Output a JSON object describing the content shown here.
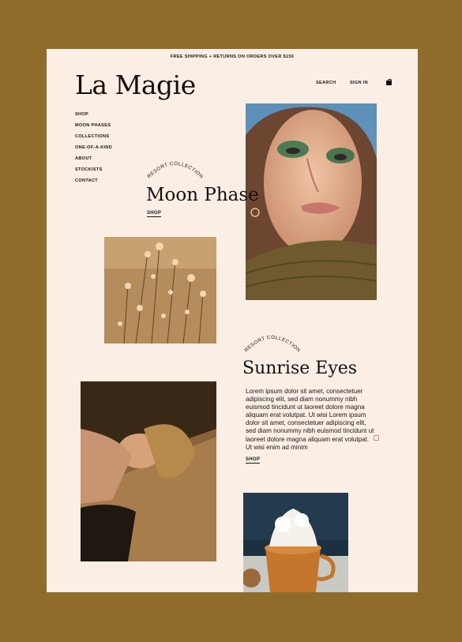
{
  "announcement": "FREE SHIPPING + RETURNS ON ORDERS OVER $150",
  "brand": "La Magie",
  "header": {
    "search": "SEARCH",
    "sign_in": "SIGN IN",
    "bag_icon": "shopping-bag-icon"
  },
  "nav": [
    "SHOP",
    "MOON PHASES",
    "COLLECTIONS",
    "ONE-OF-A-KIND",
    "ABOUT",
    "STOCKISTS",
    "CONTACT"
  ],
  "feature1": {
    "eyebrow": "RESORT COLLECTION",
    "title": "Moon Phase",
    "cta": "SHOP"
  },
  "feature2": {
    "eyebrow": "RESORT COLLECTION",
    "title": "Sunrise Eyes",
    "body": "Lorem ipsum dolor sit amet, consectetuer adipiscing elit, sed diam nonummy nibh euismod tincidunt ut laoreet dolore magna aliquam erat volutpat. Ut wisi Lorem ipsum dolor sit amet, consectetuer adipiscing elit, sed diam nonummy nibh euismod tincidunt ut laoreet dolore magna aliquam erat volutpat. Ut wisi enim ad minim",
    "cta": "SHOP"
  },
  "colors": {
    "frame": "#8f6b2c",
    "page": "#fbefe5",
    "ink": "#14110f"
  }
}
